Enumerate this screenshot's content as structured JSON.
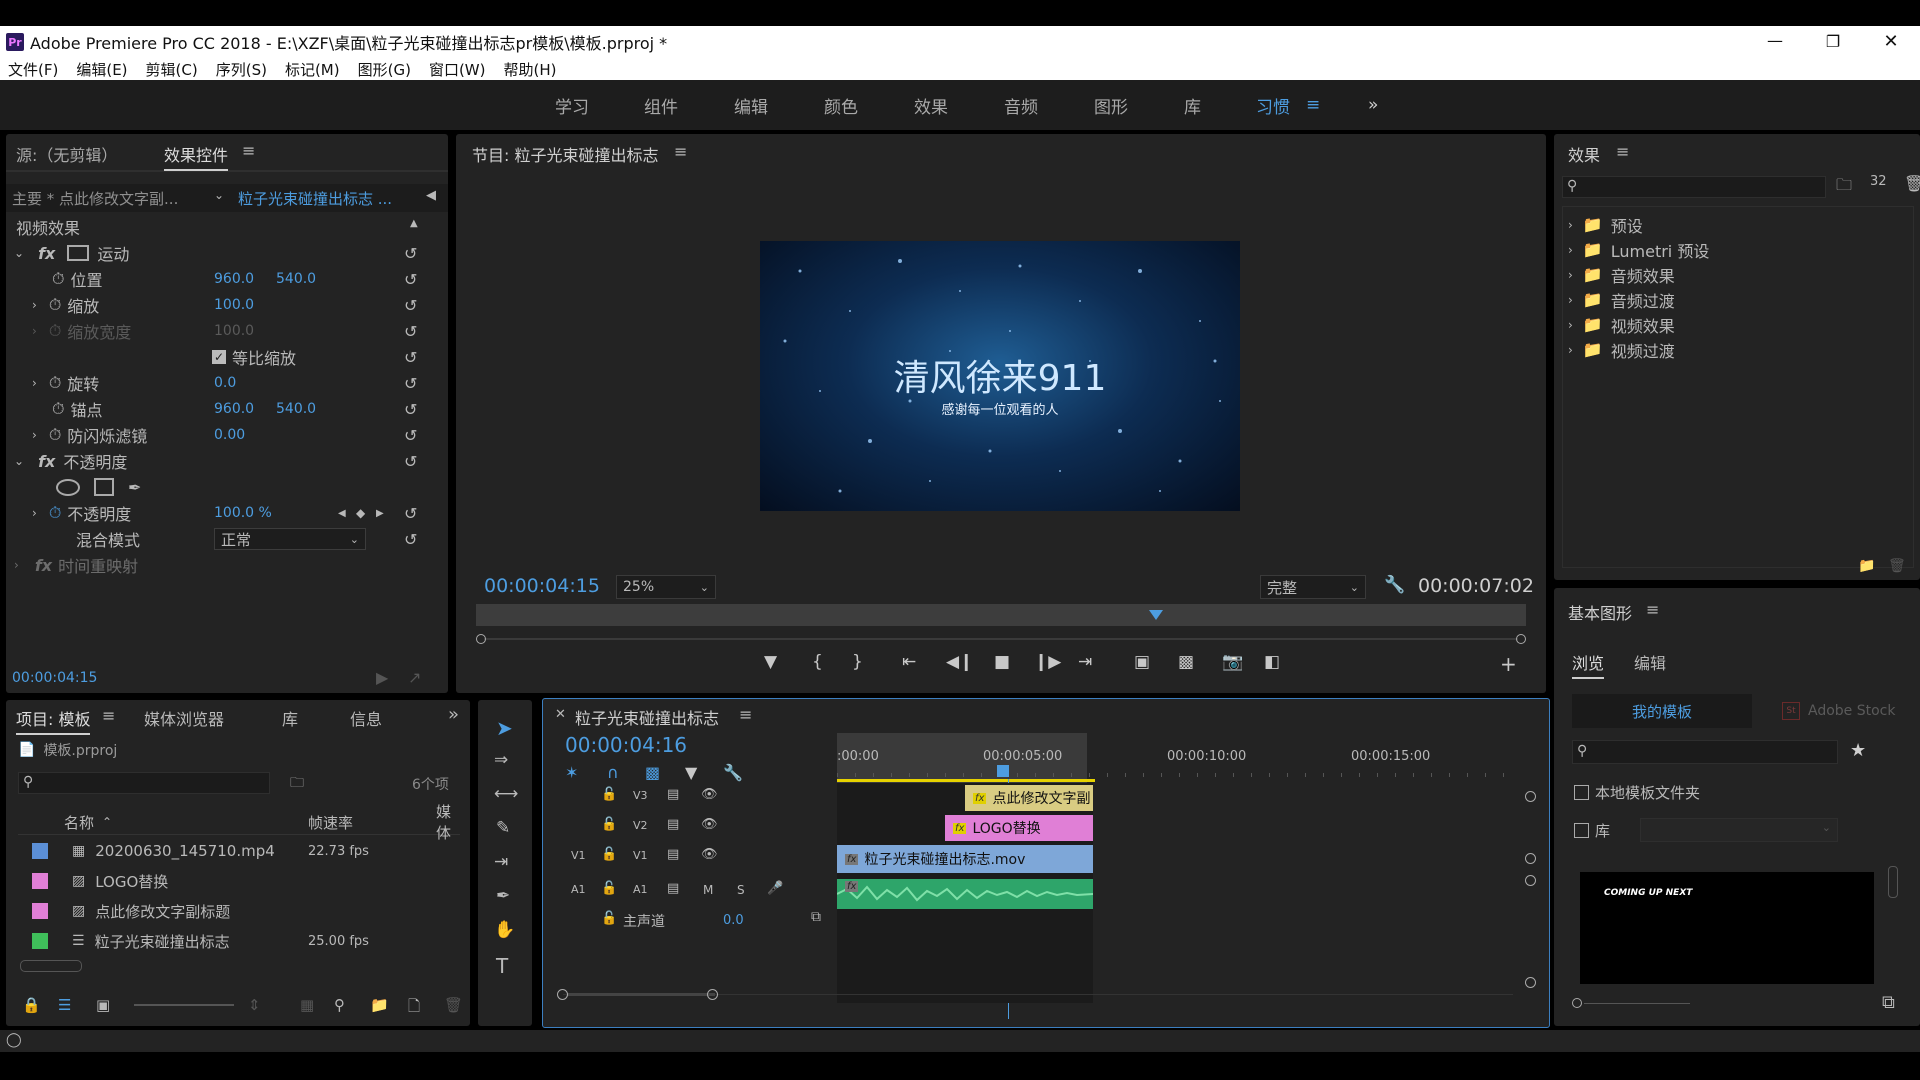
{
  "window": {
    "title": "Adobe Premiere Pro CC 2018 - E:\\XZF\\桌面\\粒子光束碰撞出标志pr模板\\模板.prproj *",
    "app_badge": "Pr"
  },
  "menu": [
    "文件(F)",
    "编辑(E)",
    "剪辑(C)",
    "序列(S)",
    "标记(M)",
    "图形(G)",
    "窗口(W)",
    "帮助(H)"
  ],
  "workspaces": {
    "tabs": [
      "学习",
      "组件",
      "编辑",
      "颜色",
      "效果",
      "音频",
      "图形",
      "库",
      "习惯"
    ],
    "active": "习惯"
  },
  "effect_controls": {
    "tab_source": "源:（无剪辑）",
    "tab_effects": "效果控件",
    "master_label": "主要 * 点此修改文字副...",
    "sequence_label": "粒子光束碰撞出标志 ...",
    "section_video": "视频效果",
    "motion": "运动",
    "position_label": "位置",
    "position_x": "960.0",
    "position_y": "540.0",
    "scale_label": "缩放",
    "scale_val": "100.0",
    "scale_width_label": "缩放宽度",
    "scale_width_val": "100.0",
    "uniform_label": "等比缩放",
    "rotation_label": "旋转",
    "rotation_val": "0.0",
    "anchor_label": "锚点",
    "anchor_x": "960.0",
    "anchor_y": "540.0",
    "flicker_label": "防闪烁滤镜",
    "flicker_val": "0.00",
    "opacity_section": "不透明度",
    "opacity_label": "不透明度",
    "opacity_val": "100.0 %",
    "blend_label": "混合模式",
    "blend_val": "正常",
    "time_remap": "时间重映射",
    "timecode": "00:00:04:15"
  },
  "program": {
    "title": "节目: 粒子光束碰撞出标志",
    "video_title": "清风徐来911",
    "video_subtitle": "感谢每一位观看的人",
    "current_time": "00:00:04:15",
    "zoom": "25%",
    "quality": "完整",
    "duration": "00:00:07:02",
    "playhead_fraction": 0.648
  },
  "effects_panel": {
    "title": "效果",
    "items": [
      "预设",
      "Lumetri 预设",
      "音频效果",
      "音频过渡",
      "视频效果",
      "视频过渡"
    ]
  },
  "essential_graphics": {
    "title": "基本图形",
    "tab_browse": "浏览",
    "tab_edit": "编辑",
    "my_templates": "我的模板",
    "adobe_stock": "Adobe Stock",
    "local_folder": "本地模板文件夹",
    "library": "库",
    "thumb_text": "COMING UP NEXT"
  },
  "project": {
    "tabs": [
      "项目: 模板",
      "媒体浏览器",
      "库",
      "信息"
    ],
    "file": "模板.prproj",
    "count": "6个项",
    "col_name": "名称",
    "col_fps": "帧速率",
    "col_media": "媒体",
    "items": [
      {
        "name": "20200630_145710.mp4",
        "fps": "22.73 fps",
        "color": "#5b8fd6"
      },
      {
        "name": "LOGO替换",
        "fps": "",
        "color": "#e07fd6"
      },
      {
        "name": "点此修改文字副标题",
        "fps": "",
        "color": "#e07fd6"
      },
      {
        "name": "粒子光束碰撞出标志",
        "fps": "25.00 fps",
        "color": "#3fbf5a"
      }
    ]
  },
  "timeline": {
    "title": "粒子光束碰撞出标志",
    "timecode": "00:00:04:16",
    "ruler": [
      ":00:00",
      "00:00:05:00",
      "00:00:10:00",
      "00:00:15:00"
    ],
    "tracks": [
      "V3",
      "V2",
      "V1",
      "A1"
    ],
    "source_v1": "V1",
    "source_a1": "A1",
    "mute": "M",
    "solo": "S",
    "master": "主声道",
    "master_val": "0.0",
    "clip_v3": "点此修改文字副",
    "clip_v2": "LOGO替换",
    "clip_v1": "粒子光束碰撞出标志.mov",
    "fx": "fx"
  },
  "colors": {
    "accent_blue": "#4d9de0",
    "clip_v3": "#d6c878",
    "clip_v2": "#e07fd6",
    "clip_v1": "#7ea7d8",
    "audio": "#2ea56a"
  }
}
